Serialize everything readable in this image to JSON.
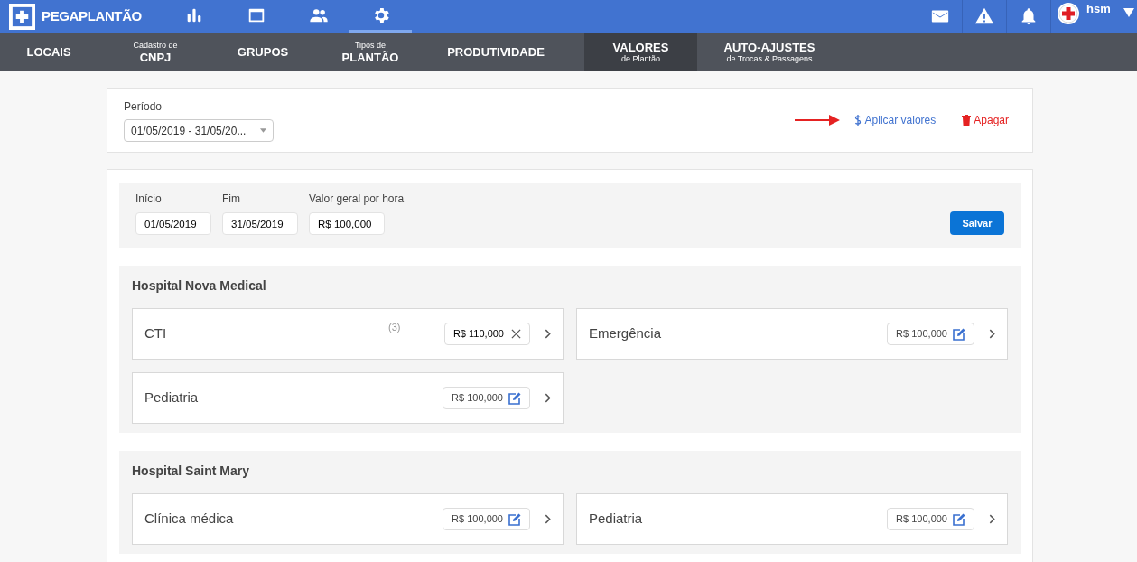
{
  "brand": "PEGAPLANTÃO",
  "top_icons": [
    {
      "kind": "chart",
      "selected": false
    },
    {
      "kind": "calendar",
      "selected": false
    },
    {
      "kind": "people",
      "selected": false
    },
    {
      "kind": "gear",
      "selected": true
    }
  ],
  "right_icons": [
    {
      "kind": "mail"
    },
    {
      "kind": "alert"
    },
    {
      "kind": "bell"
    }
  ],
  "user": {
    "name": "hsm"
  },
  "subnav": [
    {
      "label": "LOCAIS",
      "selected": false
    },
    {
      "small": "Cadastro de",
      "label": "CNPJ",
      "selected": false
    },
    {
      "label": "GRUPOS",
      "selected": false
    },
    {
      "small": "Tipos de",
      "label": "PLANTÃO",
      "selected": false
    },
    {
      "label": "PRODUTIVIDADE",
      "selected": false
    },
    {
      "label": "VALORES",
      "sub": "de Plantão",
      "selected": true
    },
    {
      "label": "AUTO-AJUSTES",
      "sub": "de Trocas & Passagens",
      "selected": false
    }
  ],
  "periodo": {
    "label": "Período",
    "value": "01/05/2019 - 31/05/20..."
  },
  "actions": {
    "apply": "Aplicar valores",
    "delete": "Apagar"
  },
  "general": {
    "fields": [
      {
        "label": "Início",
        "value": "01/05/2019"
      },
      {
        "label": "Fim",
        "value": "31/05/2019"
      },
      {
        "label": "Valor geral por hora",
        "value": "R$ 100,000"
      }
    ],
    "save": "Salvar"
  },
  "hospitals": [
    {
      "name": "Hospital Nova Medical",
      "units": [
        {
          "name": "CTI",
          "count": "(3)",
          "value": "R$ 110,000",
          "editing": true
        },
        {
          "name": "Emergência",
          "value": "R$ 100,000",
          "editing": false
        },
        {
          "name": "Pediatria",
          "value": "R$ 100,000",
          "editing": false
        }
      ]
    },
    {
      "name": "Hospital Saint Mary",
      "units": [
        {
          "name": "Clínica médica",
          "value": "R$ 100,000",
          "editing": false
        },
        {
          "name": "Pediatria",
          "value": "R$ 100,000",
          "editing": false
        }
      ]
    }
  ]
}
